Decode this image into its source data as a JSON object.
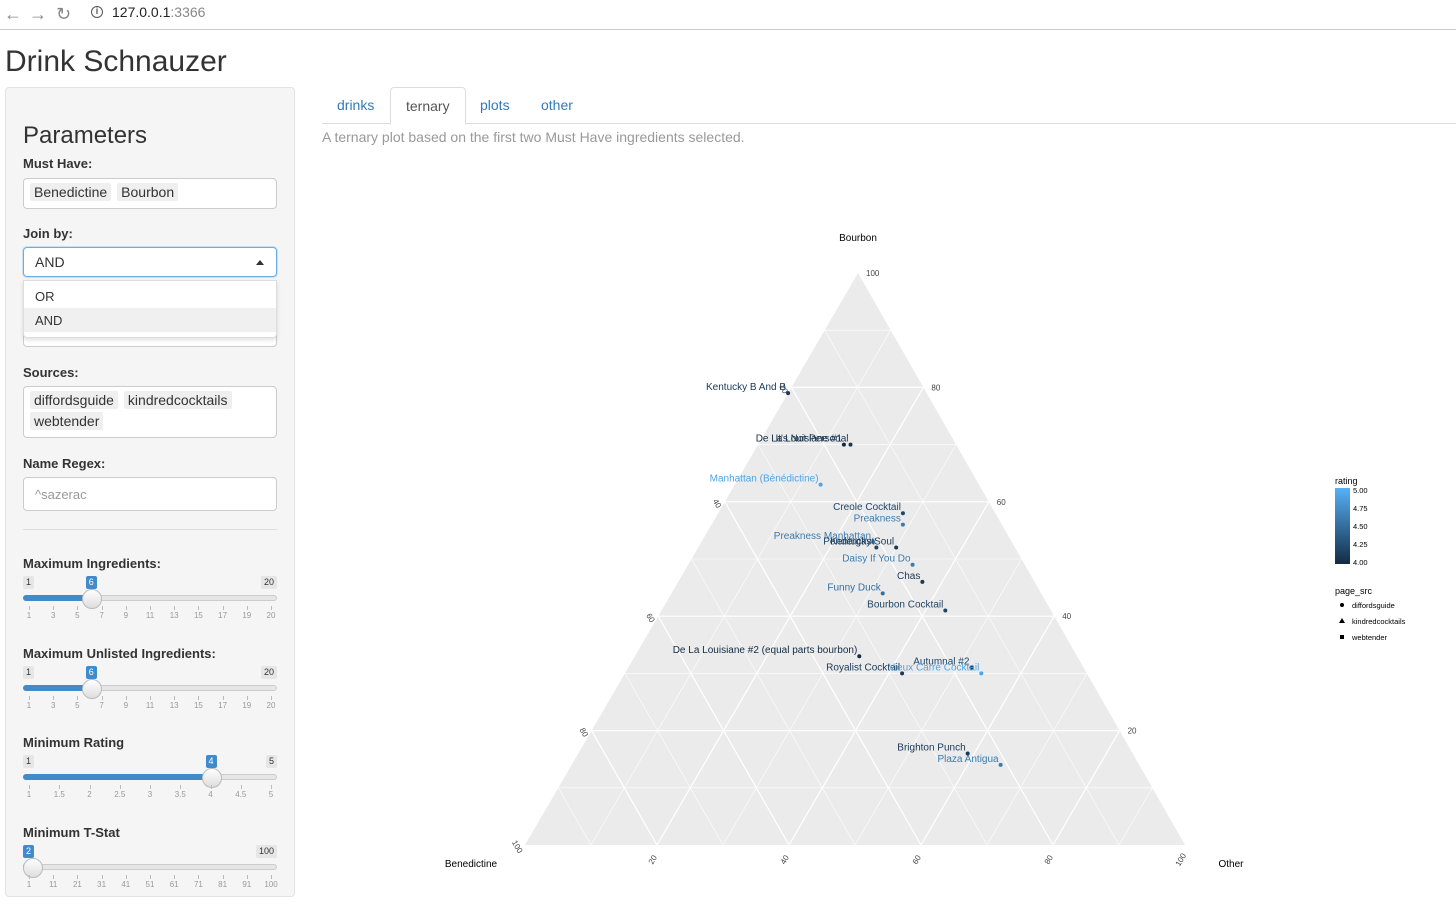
{
  "browser": {
    "url_host": "127.0.0.1",
    "url_port": ":3366"
  },
  "app_title": "Drink Schnauzer",
  "sidebar": {
    "heading": "Parameters",
    "must_have": {
      "label": "Must Have:",
      "tags": [
        "Benedictine",
        "Bourbon"
      ]
    },
    "join_by": {
      "label": "Join by:",
      "value": "AND",
      "options": [
        "OR",
        "AND"
      ]
    },
    "sources": {
      "label": "Sources:",
      "tags": [
        "diffordsguide",
        "kindredcocktails",
        "webtender"
      ]
    },
    "name_regex": {
      "label": "Name Regex:",
      "placeholder": "^sazerac"
    },
    "sliders": [
      {
        "label": "Maximum Ingredients:",
        "min": 1,
        "max": 20,
        "value": 6,
        "ticks": [
          "1",
          "3",
          "5",
          "7",
          "9",
          "11",
          "13",
          "15",
          "17",
          "19",
          "20"
        ]
      },
      {
        "label": "Maximum Unlisted Ingredients:",
        "min": 1,
        "max": 20,
        "value": 6,
        "ticks": [
          "1",
          "3",
          "5",
          "7",
          "9",
          "11",
          "13",
          "15",
          "17",
          "19",
          "20"
        ]
      },
      {
        "label": "Minimum Rating",
        "min": 1,
        "max": 5,
        "value": 4,
        "ticks": [
          "1",
          "1.5",
          "2",
          "2.5",
          "3",
          "3.5",
          "4",
          "4.5",
          "5"
        ]
      },
      {
        "label": "Minimum T-Stat",
        "min": 2,
        "max": 100,
        "value": 2,
        "ticks": [
          "1",
          "11",
          "21",
          "31",
          "41",
          "51",
          "61",
          "71",
          "81",
          "91",
          "100"
        ]
      }
    ]
  },
  "tabs": [
    "drinks",
    "ternary",
    "plots",
    "other"
  ],
  "active_tab": "ternary",
  "description": "A ternary plot based on the first two Must Have ingredients selected.",
  "chart_data": {
    "type": "scatter",
    "subtype": "ternary",
    "axes": {
      "top": "Bourbon",
      "left": "Benedictine",
      "right": "Other"
    },
    "axis_ticks": [
      "20",
      "40",
      "60",
      "80",
      "100"
    ],
    "grid": true,
    "legend_position": "right",
    "legend": {
      "rating": {
        "title": "rating",
        "labels": [
          "5.00",
          "4.75",
          "4.50",
          "4.25",
          "4.00"
        ]
      },
      "page_src": {
        "title": "page_src",
        "entries": [
          "diffordsguide",
          "kindredcocktails",
          "webtender"
        ]
      }
    },
    "points": [
      {
        "label": "Kentucky B And B",
        "bourbon": 79,
        "benedictine": 21,
        "other": 0,
        "rating": 4.1
      },
      {
        "label": "De La Louisiane #1",
        "bourbon": 70,
        "benedictine": 17,
        "other": 13,
        "rating": 4.0
      },
      {
        "label": "It's Not Personal",
        "bourbon": 70,
        "benedictine": 16,
        "other": 14,
        "rating": 4.1
      },
      {
        "label": "Manhattan (Bénédictine)",
        "bourbon": 63,
        "benedictine": 24,
        "other": 13,
        "rating": 4.9
      },
      {
        "label": "Creole Cocktail",
        "bourbon": 58,
        "benedictine": 14,
        "other": 28,
        "rating": 4.2
      },
      {
        "label": "Preakness",
        "bourbon": 56,
        "benedictine": 15,
        "other": 29,
        "rating": 4.6
      },
      {
        "label": "Preakness Manhattan",
        "bourbon": 53,
        "benedictine": 21,
        "other": 26,
        "rating": 4.6
      },
      {
        "label": "Pendergast",
        "bourbon": 52,
        "benedictine": 21,
        "other": 27,
        "rating": 4.2
      },
      {
        "label": "Kentucky Soul",
        "bourbon": 52,
        "benedictine": 18,
        "other": 30,
        "rating": 4.1
      },
      {
        "label": "Daisy If You Do",
        "bourbon": 49,
        "benedictine": 17,
        "other": 34,
        "rating": 4.6
      },
      {
        "label": "Chas",
        "bourbon": 46,
        "benedictine": 17,
        "other": 37,
        "rating": 4.1
      },
      {
        "label": "Funny Duck",
        "bourbon": 44,
        "benedictine": 24,
        "other": 32,
        "rating": 4.5
      },
      {
        "label": "Bourbon Cocktail",
        "bourbon": 41,
        "benedictine": 16,
        "other": 43,
        "rating": 4.2
      },
      {
        "label": "Autumnal #2",
        "bourbon": 31,
        "benedictine": 17,
        "other": 52,
        "rating": 4.2
      },
      {
        "label": "De La Louisiane #2 (equal parts bourbon)",
        "bourbon": 33,
        "benedictine": 33,
        "other": 34,
        "rating": 4.0
      },
      {
        "label": "Royalist Cocktail",
        "bourbon": 30,
        "benedictine": 28,
        "other": 42,
        "rating": 4.1
      },
      {
        "label": "Vieux Carré Cocktail",
        "bourbon": 30,
        "benedictine": 16,
        "other": 54,
        "rating": 4.9
      },
      {
        "label": "Brighton Punch",
        "bourbon": 16,
        "benedictine": 25,
        "other": 59,
        "rating": 4.1
      },
      {
        "label": "Plaza Antigua",
        "bourbon": 14,
        "benedictine": 21,
        "other": 65,
        "rating": 4.6
      }
    ]
  }
}
